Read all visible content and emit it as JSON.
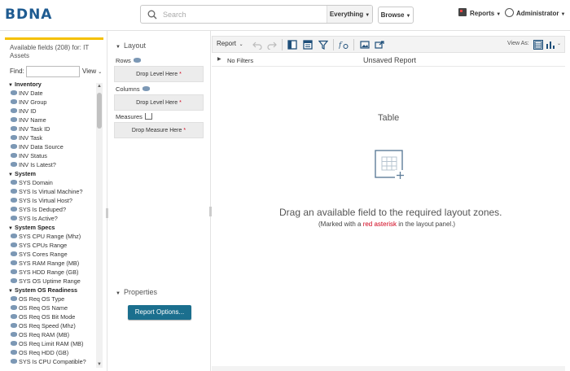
{
  "header": {
    "logo": "BDNA",
    "search_placeholder": "Search",
    "scope_label": "Everything",
    "browse_label": "Browse",
    "reports_label": "Reports",
    "admin_label": "Administrator"
  },
  "fields_panel": {
    "title": "Available fields (208) for: IT Assets",
    "find_label": "Find:",
    "view_label": "View",
    "groups": [
      {
        "label": "Inventory",
        "fields": [
          "INV Date",
          "INV Group",
          "INV ID",
          "INV Name",
          "INV Task ID",
          "INV Task",
          "INV Data Source",
          "INV Status",
          "INV Is Latest?"
        ]
      },
      {
        "label": "System",
        "fields": [
          "SYS Domain",
          "SYS Is Virtual Machine?",
          "SYS Is Virtual Host?",
          "SYS Is Deduped?",
          "SYS Is Active?"
        ]
      },
      {
        "label": "System Specs",
        "fields": [
          "SYS CPU Range (Mhz)",
          "SYS CPUs Range",
          "SYS Cores Range",
          "SYS RAM Range (MB)",
          "SYS HDD Range (GB)",
          "SYS OS Uptime Range"
        ]
      },
      {
        "label": "System OS Readiness",
        "fields": [
          "OS Req OS Type",
          "OS Req OS Name",
          "OS Req OS Bit Mode",
          "OS Req Speed (Mhz)",
          "OS Req RAM (MB)",
          "OS Req Limit RAM (MB)",
          "OS Req HDD (GB)",
          "SYS Is CPU Compatible?"
        ]
      }
    ]
  },
  "layout_panel": {
    "title": "Layout",
    "rows_label": "Rows",
    "columns_label": "Columns",
    "measures_label": "Measures",
    "drop_level": "Drop Level Here",
    "drop_measure": "Drop Measure Here",
    "required_mark": "*",
    "properties_title": "Properties",
    "report_options_label": "Report Options..."
  },
  "report": {
    "menu_label": "Report",
    "view_as_label": "View As:",
    "filters_label": "No Filters",
    "name": "Unsaved Report",
    "content_title": "Table",
    "hint_main": "Drag an available field to the required layout zones.",
    "hint_sub_before": "(Marked with a ",
    "hint_sub_red": "red asterisk",
    "hint_sub_after": " in the layout panel.)"
  },
  "colors": {
    "brand": "#1e5b91",
    "accent_line": "#f5c000",
    "primary_button": "#1b6f8e",
    "required": "#d0021b"
  }
}
